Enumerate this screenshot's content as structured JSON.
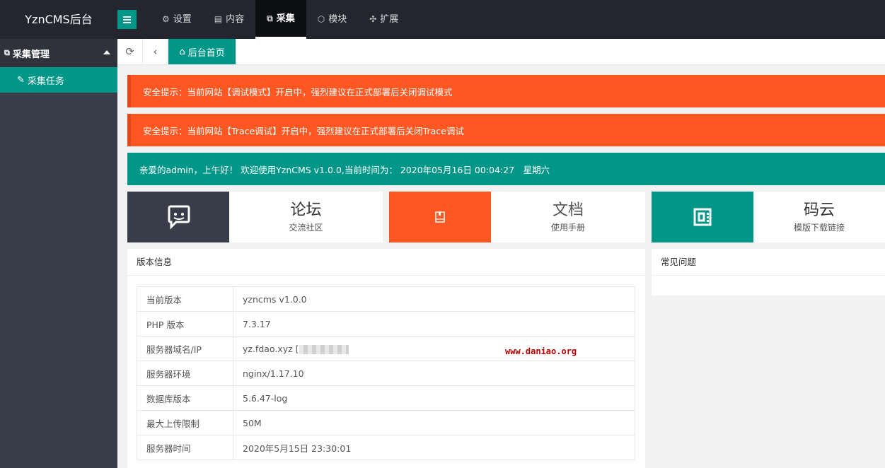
{
  "app": {
    "title": "YznCMS后台"
  },
  "topnav": [
    {
      "icon": "gear-icon",
      "glyph": "⚙",
      "label": "设置"
    },
    {
      "icon": "document-icon",
      "glyph": "▤",
      "label": "内容"
    },
    {
      "icon": "sitemap-icon",
      "glyph": "⧉",
      "label": "采集"
    },
    {
      "icon": "cube-icon",
      "glyph": "⬡",
      "label": "模块"
    },
    {
      "icon": "puzzle-icon",
      "glyph": "✣",
      "label": "扩展"
    }
  ],
  "sidebar": {
    "group_label": "采集管理",
    "items": [
      {
        "label": "采集任务",
        "icon": "edit-icon"
      }
    ]
  },
  "tabs": {
    "home_label": "后台首页"
  },
  "alerts": [
    "安全提示：当前网站【调试模式】开启中，强烈建议在正式部署后关闭调试模式",
    "安全提示：当前网站【Trace调试】开启中，强烈建议在正式部署后关闭Trace调试"
  ],
  "welcome": "亲爱的admin，上午好！ 欢迎使用YznCMS v1.0.0,当前时间为： 2020年05月16日 00:04:27　星期六",
  "cards": [
    {
      "title": "论坛",
      "subtitle": "交流社区",
      "icon": "chat-icon",
      "color": "#393d49"
    },
    {
      "title": "文档",
      "subtitle": "使用手册",
      "icon": "book-icon",
      "color": "#ff5722"
    },
    {
      "title": "码云",
      "subtitle": "模版下载链接",
      "icon": "code-icon",
      "color": "#009688"
    }
  ],
  "version_panel": {
    "title": "版本信息",
    "rows": [
      {
        "key": "当前版本",
        "value": "yzncms v1.0.0"
      },
      {
        "key": "PHP 版本",
        "value": "7.3.17"
      },
      {
        "key": "服务器域名/IP",
        "value": "yz.fdao.xyz ["
      },
      {
        "key": "服务器环境",
        "value": "nginx/1.17.10"
      },
      {
        "key": "数据库版本",
        "value": "5.6.47-log"
      },
      {
        "key": "最大上传限制",
        "value": "50M"
      },
      {
        "key": "服务器时间",
        "value": "2020年5月15日 23:30:01"
      }
    ]
  },
  "faq_panel": {
    "title": "常见问题"
  },
  "watermark": "www.daniao.org"
}
